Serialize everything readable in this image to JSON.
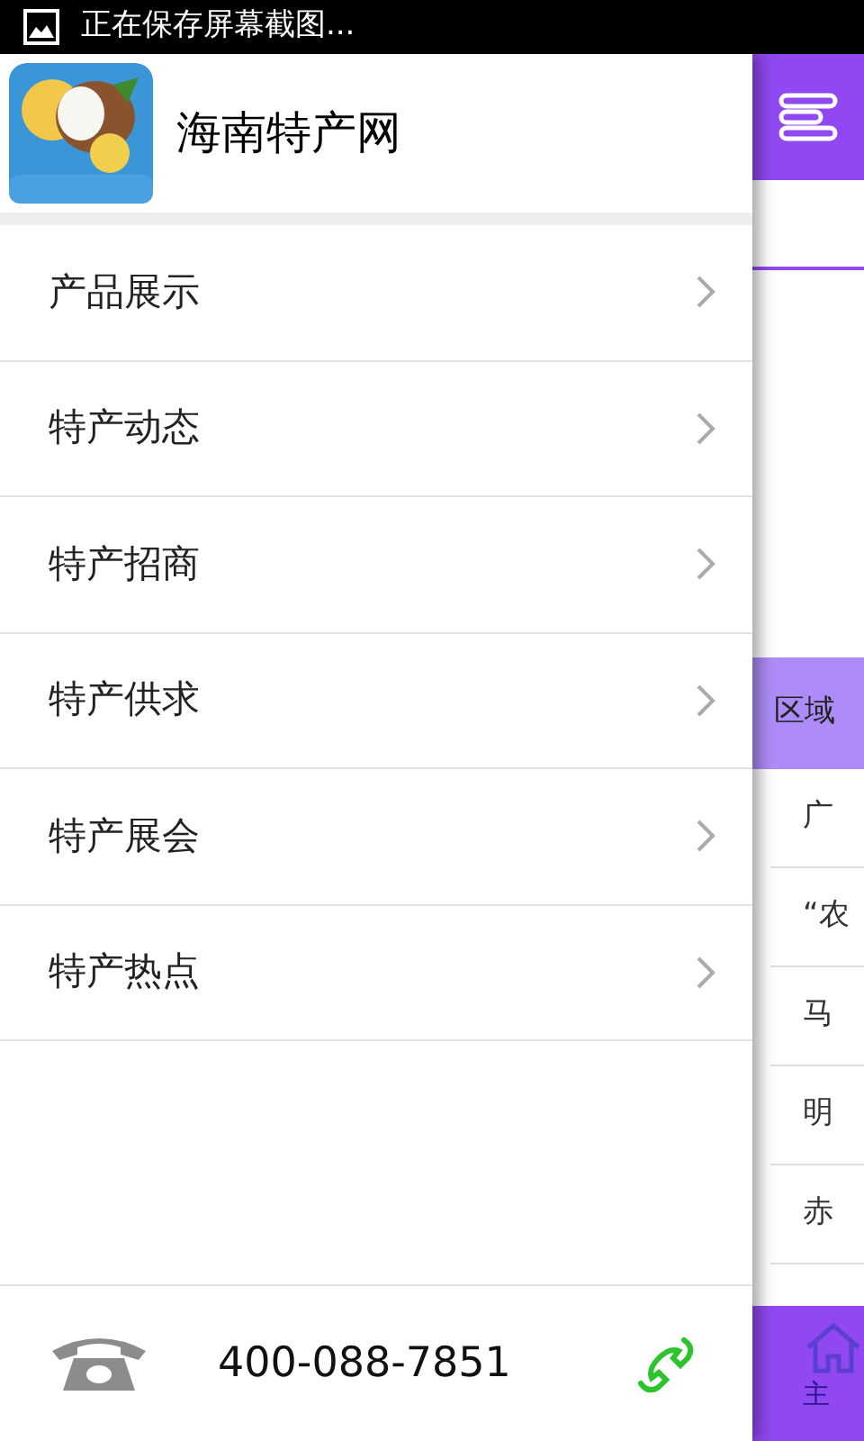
{
  "status_bar": {
    "notification": "正在保存屏幕截图..."
  },
  "drawer": {
    "title": "海南特产网",
    "menu": [
      {
        "label": "产品展示"
      },
      {
        "label": "特产动态"
      },
      {
        "label": "特产招商"
      },
      {
        "label": "特产供求"
      },
      {
        "label": "特产展会"
      },
      {
        "label": "特产热点"
      }
    ],
    "phone": "400-088-7851"
  },
  "behind": {
    "section_title": "区域",
    "items": [
      "广",
      "“农",
      "马",
      "明",
      "赤"
    ],
    "nav": [
      {
        "label": "主",
        "selected": true
      }
    ]
  }
}
